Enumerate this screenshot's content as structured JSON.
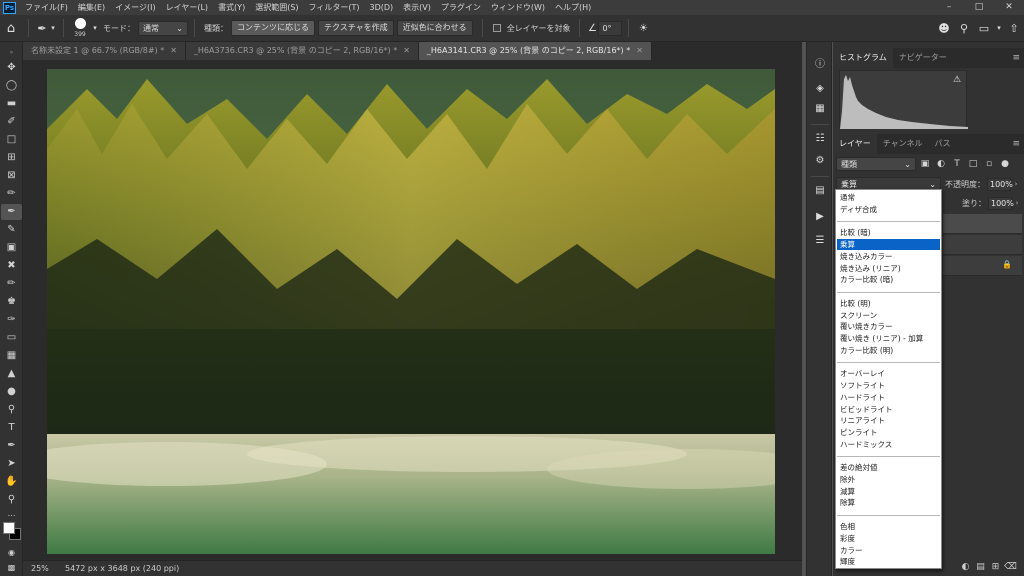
{
  "app": {
    "logo": "Ps"
  },
  "menubar": {
    "items": [
      "ファイル(F)",
      "編集(E)",
      "イメージ(I)",
      "レイヤー(L)",
      "書式(Y)",
      "選択範囲(S)",
      "フィルター(T)",
      "3D(D)",
      "表示(V)",
      "プラグイン",
      "ウィンドウ(W)",
      "ヘルプ(H)"
    ]
  },
  "options": {
    "brush_size": "399",
    "mode_label": "モード：",
    "mode_value": "通常",
    "type_label": "種類：",
    "type_buttons": [
      "コンテンツに応じる",
      "テクスチャを作成",
      "近似色に合わせる"
    ],
    "all_layers_label": "全レイヤーを対象",
    "angle_value": "0°"
  },
  "tabs": [
    {
      "label": "名称未設定 1 @ 66.7% (RGB/8#) *",
      "active": false
    },
    {
      "label": "_H6A3736.CR3 @ 25% (背景 のコピー 2, RGB/16*) *",
      "active": false
    },
    {
      "label": "_H6A3141.CR3 @ 25% (背景 のコピー 2, RGB/16*) *",
      "active": true
    }
  ],
  "statusbar": {
    "zoom": "25%",
    "doc_info": "5472 px x 3648 px (240 ppi)"
  },
  "panels": {
    "top_tabs": [
      "ヒストグラム",
      "ナビゲーター"
    ],
    "layers_tabs": [
      "レイヤー",
      "チャンネル",
      "パス"
    ],
    "filter_kind": "種類",
    "blend_mode": "乗算",
    "opacity_label": "不透明度：",
    "opacity_value": "100%",
    "fill_label": "塗り：",
    "fill_value": "100%"
  },
  "blend_dropdown": {
    "highlighted": "乗算",
    "groups": [
      [
        "通常",
        "ディザ合成"
      ],
      [
        "比較 (暗)",
        "乗算",
        "焼き込みカラー",
        "焼き込み (リニア)",
        "カラー比較 (暗)"
      ],
      [
        "比較 (明)",
        "スクリーン",
        "覆い焼きカラー",
        "覆い焼き (リニア) - 加算",
        "カラー比較 (明)"
      ],
      [
        "オーバーレイ",
        "ソフトライト",
        "ハードライト",
        "ビビッドライト",
        "リニアライト",
        "ピンライト",
        "ハードミックス"
      ],
      [
        "差の絶対値",
        "除外",
        "減算",
        "除算"
      ],
      [
        "色相",
        "彩度",
        "カラー",
        "輝度"
      ]
    ]
  },
  "colors": {
    "accent": "#0a64c8",
    "foreground_swatch": "#ffffff",
    "background_swatch": "#000000"
  }
}
